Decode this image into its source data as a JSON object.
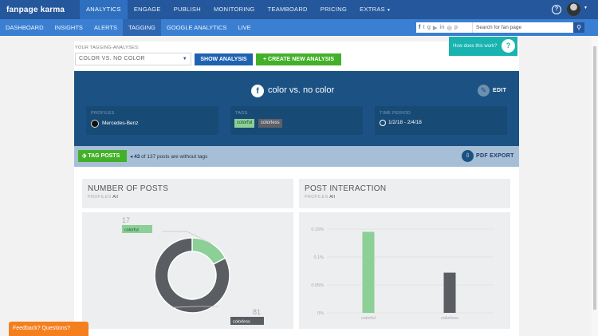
{
  "top_nav": {
    "logo": "fanpage karma",
    "items": [
      "ANALYTICS",
      "ENGAGE",
      "PUBLISH",
      "MONITORING",
      "TEAMBOARD",
      "PRICING",
      "EXTRAS"
    ],
    "active": "ANALYTICS"
  },
  "sub_nav": {
    "items": [
      "DASHBOARD",
      "INSIGHTS",
      "ALERTS",
      "TAGGING",
      "GOOGLE ANALYTICS",
      "LIVE"
    ],
    "active": "TAGGING",
    "search_placeholder": "Search for fan page"
  },
  "help_box": {
    "label": "How does this work?"
  },
  "analysis_select": {
    "label": "YOUR TAGGING-ANALYSES:",
    "value": "COLOR VS. NO COLOR",
    "show_button": "SHOW ANALYSIS",
    "create_button": "+ CREATE NEW ANALYSIS"
  },
  "banner": {
    "title": "color vs. no color",
    "edit_label": "EDIT",
    "profiles_label": "PROFILES",
    "profile_name": "Mercedes-Benz",
    "tags_label": "TAGS",
    "tags": [
      "colorful",
      "colorless"
    ],
    "period_label": "TIME PERIOD",
    "period": "1/2/18 - 2/4/18"
  },
  "toolbar": {
    "tag_posts_button": "TAG POSTS",
    "untagged_count": "43",
    "untagged_text": " of 137 posts are without tags",
    "pdf_export": "PDF EXPORT"
  },
  "panels": {
    "posts": {
      "title": "NUMBER OF POSTS",
      "profiles_label": "PROFILES",
      "profiles_value": "All"
    },
    "interaction": {
      "title": "POST INTERACTION",
      "profiles_label": "PROFILES",
      "profiles_value": "All"
    }
  },
  "feedback_label": "Feedback? Questions?",
  "colors": {
    "colorful": "#8ccf97",
    "colorless": "#5a5d62",
    "accent": "#24579c"
  },
  "chart_data": [
    {
      "type": "pie",
      "title": "NUMBER OF POSTS",
      "categories": [
        "colorful",
        "colorless"
      ],
      "values": [
        17,
        81
      ]
    },
    {
      "type": "bar",
      "title": "POST INTERACTION",
      "categories": [
        "colorful",
        "colorless"
      ],
      "values": [
        0.145,
        0.072
      ],
      "ylim": [
        0,
        0.15
      ],
      "yticks": [
        "0%",
        "0.05%",
        "0.1%",
        "0.15%"
      ]
    }
  ]
}
